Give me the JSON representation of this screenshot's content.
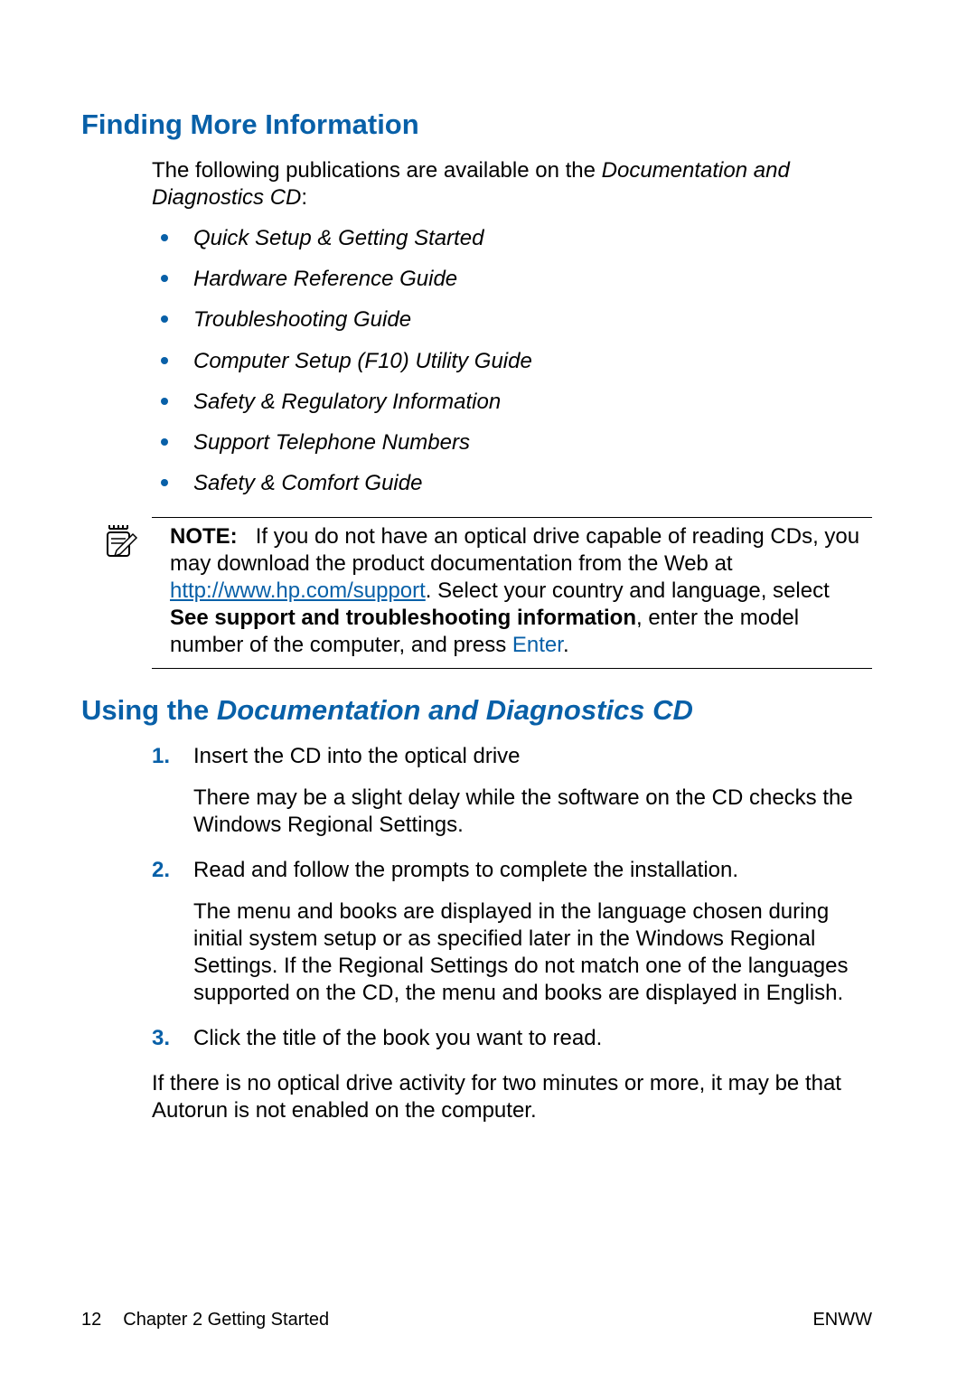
{
  "heading1": "Finding More Information",
  "intro_plain": "The following publications are available on the ",
  "intro_italic": "Documentation and Diagnostics CD",
  "intro_tail": ":",
  "publications": [
    "Quick Setup & Getting Started",
    "Hardware Reference Guide",
    "Troubleshooting Guide",
    "Computer Setup (F10) Utility Guide",
    "Safety & Regulatory Information",
    "Support Telephone Numbers",
    "Safety & Comfort Guide"
  ],
  "note": {
    "label": "NOTE:",
    "part1": "If you do not have an optical drive capable of reading CDs, you may download the product documentation from the Web at ",
    "link_text": "http://www.hp.com/support",
    "part2": ". Select your country and language, select ",
    "bold": "See support and troubleshooting information",
    "part3": ", enter the model number of the computer, and press ",
    "enter": "Enter",
    "part4": "."
  },
  "heading2_plain": "Using the ",
  "heading2_italic": "Documentation and Diagnostics CD",
  "steps": [
    {
      "main": "Insert the CD into the optical drive",
      "sub": "There may be a slight delay while the software on the CD checks the Windows Regional Settings."
    },
    {
      "main": "Read and follow the prompts to complete the installation.",
      "sub": "The menu and books are displayed in the language chosen during initial system setup or as specified later in the Windows Regional Settings. If the Regional Settings do not match one of the languages supported on the CD, the menu and books are displayed in English."
    },
    {
      "main": "Click the title of the book you want to read.",
      "sub": ""
    }
  ],
  "after_list": "If there is no optical drive activity for two minutes or more, it may be that Autorun is not enabled on the computer.",
  "footer": {
    "page": "12",
    "chapter": "Chapter 2   Getting Started",
    "lang": "ENWW"
  }
}
